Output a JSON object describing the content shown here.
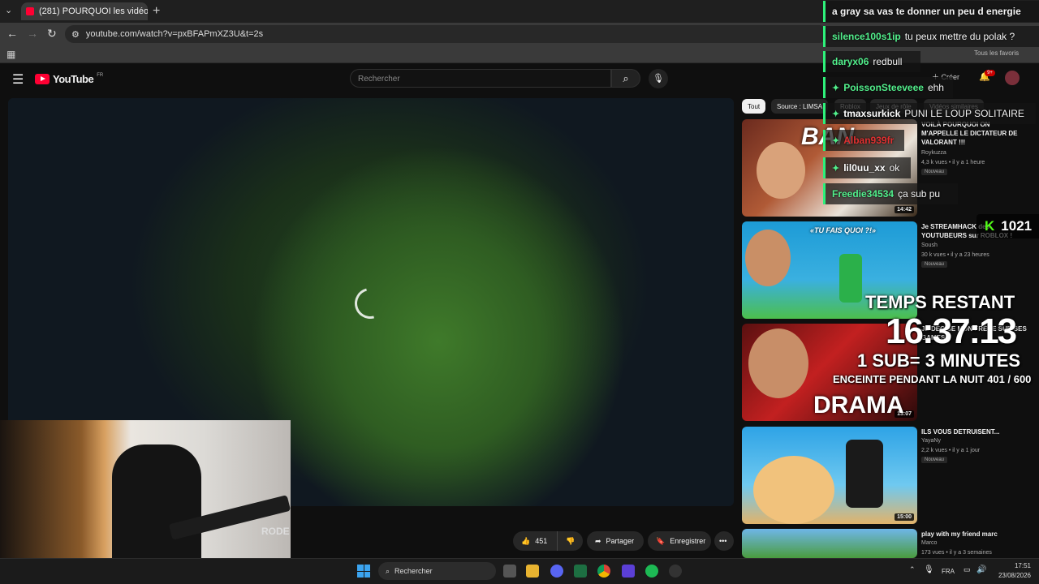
{
  "browser": {
    "tab_title": "(281) POURQUOI les vidéos Rol",
    "tab_close": "✕",
    "new_tab": "+",
    "url": "youtube.com/watch?v=pxBFAPmXZ3U&t=2s",
    "all_favorites": "Tous les favoris"
  },
  "youtube": {
    "logo_text": "YouTube",
    "logo_country": "FR",
    "search_placeholder": "Rechercher",
    "create_label": "Créer",
    "notif_count": "9+",
    "chips": [
      "Tout",
      "Source : LIMSA",
      "Roblox",
      "Jeux de rôle",
      "Vidéos similaires"
    ],
    "actions": {
      "likes": "451",
      "share": "Partager",
      "save": "Enregistrer"
    }
  },
  "recommendations": [
    {
      "title": "VOILÀ POURQUOI ON M'APPELLE LE DICTATEUR DE VALORANT !!!",
      "channel": "Roykuzza",
      "meta": "4,3 k vues • il y a 1 heure",
      "badge": "Nouveau",
      "duration": "14:42",
      "thumb_text": "BAN"
    },
    {
      "title": "Je STREAMHACK des YOUTUBEURS sur ROBLOX !",
      "channel": "Soush",
      "meta": "30 k vues • il y a 23 heures",
      "badge": "Nouveau",
      "duration": "",
      "thumb_text": "«TU FAIS QUOI ?!»"
    },
    {
      "title": "JE DÉGISE MON FRÈRE SUR SES GAMES",
      "channel": "",
      "meta": "",
      "badge": "",
      "duration": "13:07",
      "thumb_text": "DRAMA"
    },
    {
      "title": "ILS VOUS DETRUISENT...",
      "channel": "YayaNy",
      "meta": "2,2 k vues • il y a 1 jour",
      "badge": "Nouveau",
      "duration": "15:00",
      "thumb_text": ""
    },
    {
      "title": "play with my friend marc",
      "channel": "Marco",
      "meta": "173 vues • il y a 3 semaines",
      "badge": "",
      "duration": "",
      "thumb_text": ""
    }
  ],
  "chat": [
    {
      "user": "",
      "message": "a gray sa vas te donner un peu d energie"
    },
    {
      "user": "silence100s1ip",
      "message": "tu peux mettre du polak ?"
    },
    {
      "user": "daryx06",
      "message": "redbull"
    },
    {
      "user": "PoissonSteeveee",
      "message": "ehh"
    },
    {
      "user": "tmaxsurkick",
      "message": "PUNI LE LOUP SOLITAIRE"
    },
    {
      "user": "Alban939fr",
      "message": ""
    },
    {
      "user": "lil0uu_xx",
      "message": "ok"
    },
    {
      "user": "Freedie34534",
      "message": "ça sub pu"
    }
  ],
  "overlay": {
    "viewer_count": "1021",
    "line1": "TEMPS RESTANT",
    "timer": "16:37:13",
    "line3": "1 SUB= 3 MINUTES",
    "line4": "ENCEINTE PENDANT LA NUIT 401 / 600"
  },
  "webcam": {
    "brand": "RODE"
  },
  "taskbar": {
    "search_placeholder": "Rechercher",
    "lang": "FRA",
    "time": "17:51",
    "date": "23/08/2026"
  }
}
